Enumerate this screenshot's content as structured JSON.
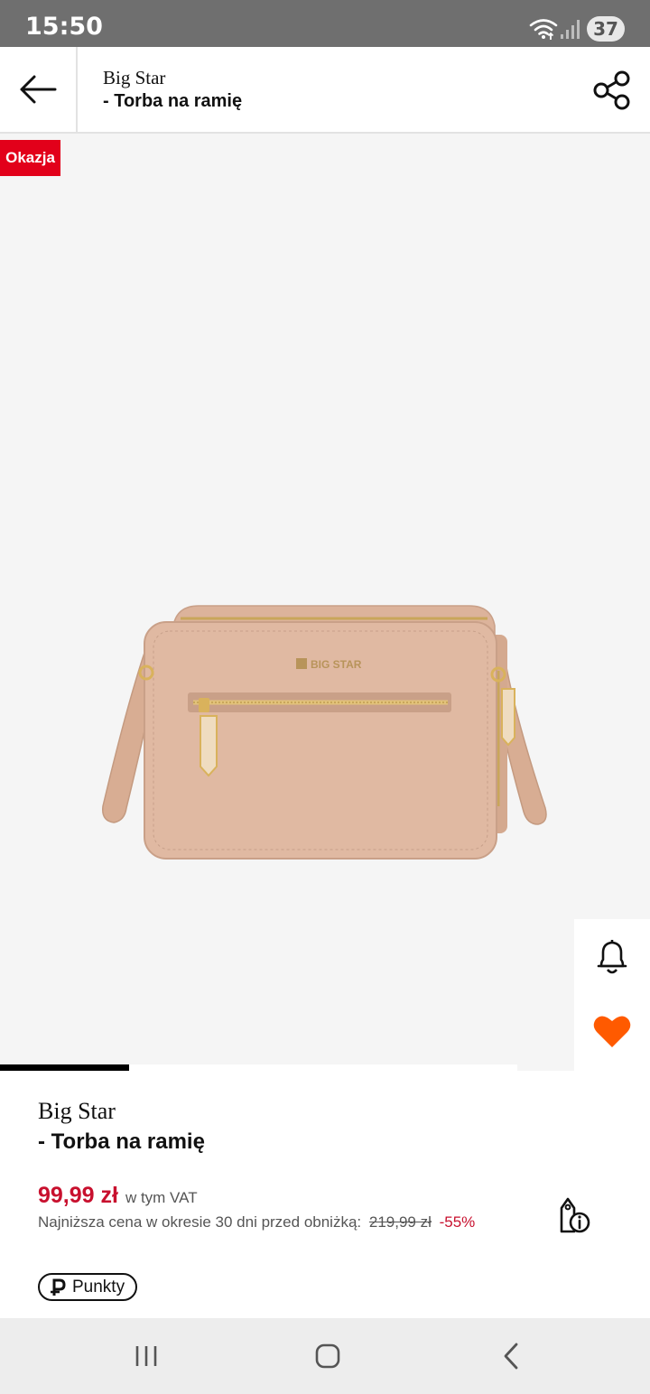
{
  "status_bar": {
    "time": "15:50",
    "battery": "37",
    "icons": [
      "wifi-icon",
      "signal-icon"
    ]
  },
  "header": {
    "brand": "Big Star",
    "title": "- Torba na ramię",
    "back_icon": "arrow-left-icon",
    "share_icon": "share-icon"
  },
  "gallery": {
    "badge": "Okazja",
    "logo_text": "BIG STAR",
    "progress_fraction": 0.25,
    "actions": [
      "bell-icon",
      "heart-icon"
    ]
  },
  "product": {
    "brand": "Big Star",
    "name": "- Torba na ramię",
    "price": "99,99 zł",
    "vat": "w tym VAT",
    "lowest_label": "Najniższa cena w okresie 30 dni przed obniżką:",
    "old_price": "219,99 zł",
    "discount": "-55%",
    "points": "Punkty"
  },
  "nav_bar": {
    "icons": [
      "recents-icon",
      "home-icon",
      "back-icon"
    ]
  },
  "colors": {
    "accent_red": "#c8102e",
    "badge_red": "#e2001a",
    "heart_orange": "#ff5a00",
    "status_bar": "#6f6f6f",
    "gallery_bg": "#f5f5f5"
  }
}
